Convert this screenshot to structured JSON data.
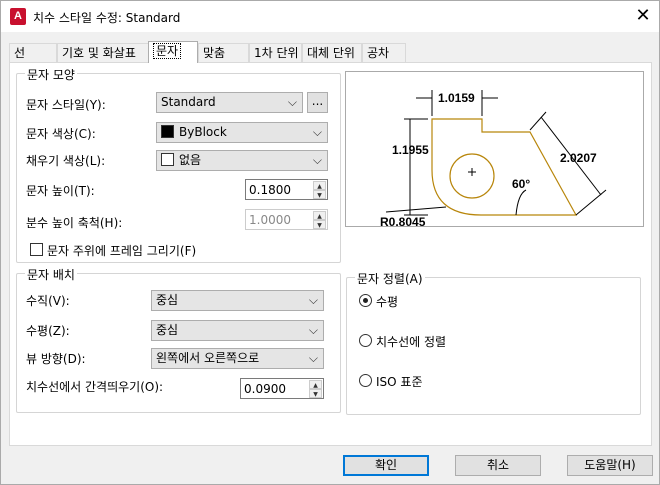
{
  "window": {
    "title": "치수 스타일 수정: Standard",
    "app_icon_letter": "A"
  },
  "tabs": [
    {
      "label": "선"
    },
    {
      "label": "기호 및 화살표"
    },
    {
      "label": "문자"
    },
    {
      "label": "맞춤"
    },
    {
      "label": "1차 단위"
    },
    {
      "label": "대체 단위"
    },
    {
      "label": "공차"
    }
  ],
  "text_appearance": {
    "group_label": "문자 모양",
    "style_label": "문자 스타일(Y):",
    "style_value": "Standard",
    "style_browse": "...",
    "color_label": "문자 색상(C):",
    "color_value": "ByBlock",
    "fill_label": "채우기 색상(L):",
    "fill_value": "없음",
    "height_label": "문자 높이(T):",
    "height_value": "0.1800",
    "fraction_label": "분수 높이 축척(H):",
    "fraction_value": "1.0000",
    "frame_label": "문자 주위에 프레임 그리기(F)"
  },
  "text_placement": {
    "group_label": "문자 배치",
    "vertical_label": "수직(V):",
    "vertical_value": "중심",
    "horizontal_label": "수평(Z):",
    "horizontal_value": "중심",
    "view_label": "뷰 방향(D):",
    "view_value": "왼쪽에서 오른쪽으로",
    "offset_label": "치수선에서 간격띄우기(O):",
    "offset_value": "0.0900"
  },
  "text_alignment": {
    "group_label": "문자 정렬(A)",
    "options": [
      {
        "label": "수평",
        "selected": true
      },
      {
        "label": "치수선에 정렬",
        "selected": false
      },
      {
        "label": "ISO 표준",
        "selected": false
      }
    ]
  },
  "preview": {
    "dims": [
      "1.0159",
      "1.1955",
      "2.0207",
      "60°",
      "R0.8045"
    ]
  },
  "buttons": {
    "ok": "확인",
    "cancel": "취소",
    "help": "도움말(H)"
  }
}
